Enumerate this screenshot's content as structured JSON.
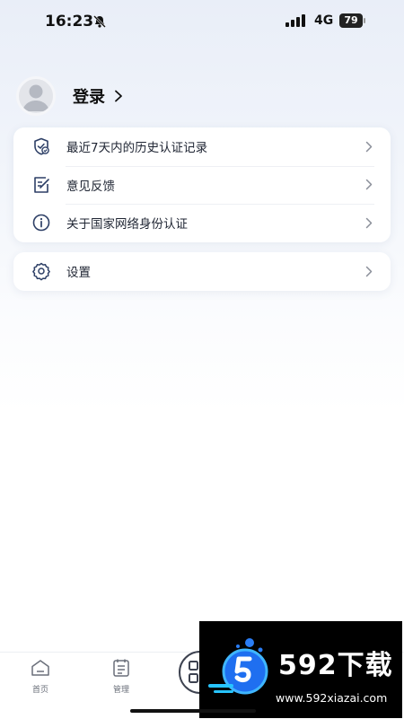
{
  "status_bar": {
    "time": "16:23",
    "network": "4G",
    "battery": "79"
  },
  "profile": {
    "login_label": "登录"
  },
  "menu": {
    "group1": [
      {
        "label": "最近7天内的历史认证记录",
        "icon": "shield-check-icon"
      },
      {
        "label": "意见反馈",
        "icon": "edit-note-icon"
      },
      {
        "label": "关于国家网络身份认证",
        "icon": "info-icon"
      }
    ],
    "group2": [
      {
        "label": "设置",
        "icon": "gear-icon"
      }
    ]
  },
  "bottom_nav": {
    "items": [
      {
        "label": "首页",
        "icon": "home-icon"
      },
      {
        "label": "管理",
        "icon": "list-icon"
      }
    ],
    "scan_icon": "qr-scan-icon"
  },
  "watermark": {
    "title": "592下载",
    "url": "www.592xiazai.com"
  },
  "colors": {
    "icon": "#2d3f66",
    "chevron": "#8a8f99",
    "background_top": "#e9eef8"
  }
}
